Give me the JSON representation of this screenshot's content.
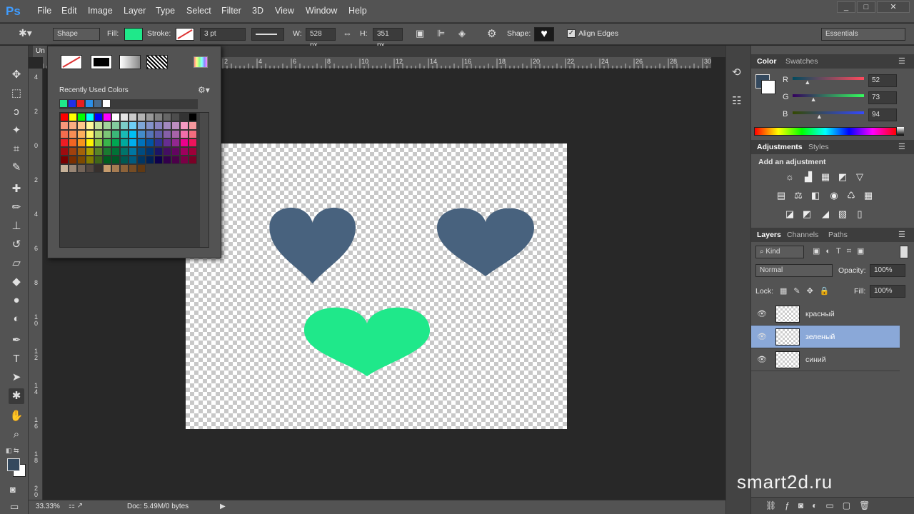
{
  "app": {
    "logo": "Ps"
  },
  "menu": [
    "File",
    "Edit",
    "Image",
    "Layer",
    "Type",
    "Select",
    "Filter",
    "3D",
    "View",
    "Window",
    "Help"
  ],
  "window_controls": [
    "_",
    "□",
    "✕"
  ],
  "options": {
    "mode": "Shape",
    "fill_label": "Fill:",
    "fill_color": "#1fe88a",
    "stroke_label": "Stroke:",
    "stroke_width": "3 pt",
    "w_label": "W:",
    "w_value": "528 px",
    "h_label": "H:",
    "h_value": "351 px",
    "shape_label": "Shape:",
    "align_edges": "Align Edges",
    "workspace": "Essentials"
  },
  "doc_tab": "Un",
  "ruler_h": [
    "2",
    "4",
    "6",
    "8",
    "10",
    "12",
    "14",
    "16",
    "18",
    "20",
    "22",
    "24",
    "26",
    "28",
    "30"
  ],
  "ruler_v": [
    "4",
    "2",
    "0",
    "2",
    "4",
    "6",
    "8",
    "1\n0",
    "1\n2",
    "1\n4",
    "1\n6",
    "1\n8",
    "2\n0"
  ],
  "status": {
    "zoom": "33.33%",
    "doc": "Doc: 5.49M/0 bytes"
  },
  "popup": {
    "title": "Recently Used Colors",
    "recent": [
      "#1fe88a",
      "#1f2fe8",
      "#e81f1f",
      "#2b8fe8",
      "#4a6a8a",
      "#ffffff"
    ]
  },
  "canvas": {
    "hearts": [
      {
        "color": "#48627e"
      },
      {
        "color": "#48627e"
      },
      {
        "color": "#1fe88a"
      }
    ]
  },
  "color_panel": {
    "tabs": [
      "Color",
      "Swatches"
    ],
    "r_label": "R",
    "g_label": "G",
    "b_label": "B",
    "r": "52",
    "g": "73",
    "b": "94",
    "fg": "#34495e"
  },
  "adjustments": {
    "tabs": [
      "Adjustments",
      "Styles"
    ],
    "title": "Add an adjustment"
  },
  "layers": {
    "tabs": [
      "Layers",
      "Channels",
      "Paths"
    ],
    "kind": "Kind",
    "blend": "Normal",
    "opacity_label": "Opacity:",
    "opacity": "100%",
    "lock_label": "Lock:",
    "fill_label": "Fill:",
    "fill": "100%",
    "items": [
      {
        "name": "красный",
        "selected": false
      },
      {
        "name": "зеленый",
        "selected": true
      },
      {
        "name": "синий",
        "selected": false
      }
    ]
  },
  "watermark": "smart2d.ru"
}
